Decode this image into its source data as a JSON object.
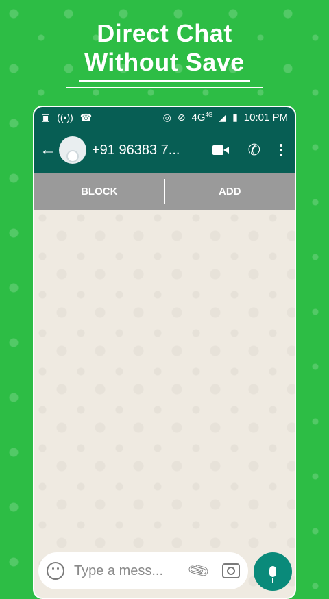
{
  "headline": {
    "line1": "Direct Chat",
    "line2": "Without Save"
  },
  "status_bar": {
    "network": "4G",
    "network_sup": "4G",
    "time": "10:01 PM"
  },
  "app_bar": {
    "contact": "+91 96383 7..."
  },
  "action_bar": {
    "block_label": "BLOCK",
    "add_label": "ADD"
  },
  "composer": {
    "placeholder": "Type a mess..."
  },
  "colors": {
    "bg_green": "#2dbd45",
    "header_teal": "#075e54",
    "mic_teal": "#0a8a7a",
    "action_gray": "#9a9a9a"
  }
}
